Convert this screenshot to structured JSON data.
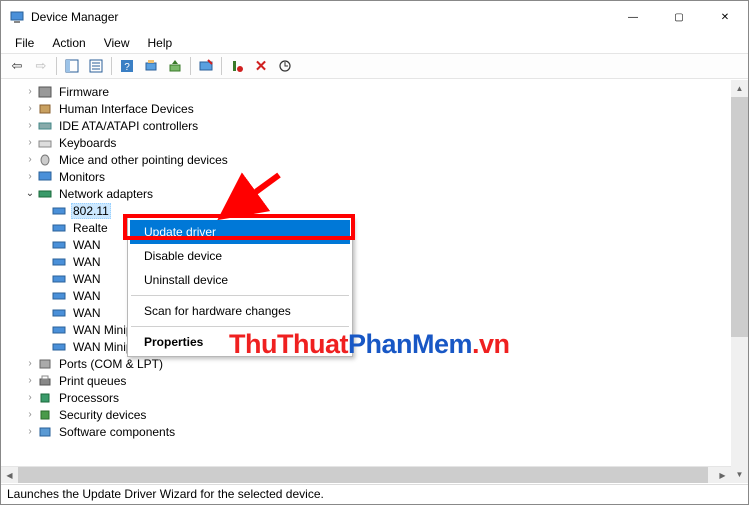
{
  "window": {
    "title": "Device Manager",
    "minimize": "—",
    "maximize": "▢",
    "close": "✕"
  },
  "menus": {
    "file": "File",
    "action": "Action",
    "view": "View",
    "help": "Help"
  },
  "tree": {
    "firmware": "Firmware",
    "hid": "Human Interface Devices",
    "ide": "IDE ATA/ATAPI controllers",
    "keyboards": "Keyboards",
    "mice": "Mice and other pointing devices",
    "monitors": "Monitors",
    "network": "Network adapters",
    "net_children": [
      "802.11",
      "Realte",
      "WAN",
      "WAN",
      "WAN",
      "WAN",
      "WAN",
      "WAN Miniport (PPTP)",
      "WAN Miniport (SSTP)"
    ],
    "ports": "Ports (COM & LPT)",
    "printqueues": "Print queues",
    "processors": "Processors",
    "security": "Security devices",
    "software": "Software components"
  },
  "context_menu": {
    "update": "Update driver",
    "disable": "Disable device",
    "uninstall": "Uninstall device",
    "scan": "Scan for hardware changes",
    "properties": "Properties"
  },
  "status": "Launches the Update Driver Wizard for the selected device.",
  "watermark": {
    "p1": "ThuThuat",
    "p2": "PhanMem",
    "p3": ".vn"
  }
}
